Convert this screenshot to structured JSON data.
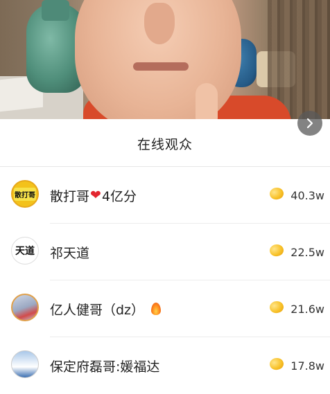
{
  "video": {
    "next_icon": "chevron-right-icon"
  },
  "panel": {
    "title": "在线观众"
  },
  "viewers": [
    {
      "name": "散打哥",
      "suffix": "4亿分",
      "badge_icon": "heart-icon",
      "avatar_text": "散打哥",
      "coins": "40.3w"
    },
    {
      "name": "祁天道",
      "suffix": "",
      "badge_icon": "",
      "avatar_text": "天道",
      "coins": "22.5w"
    },
    {
      "name": "亿人健哥（dz）",
      "suffix": "",
      "badge_icon": "fire-icon",
      "avatar_text": "",
      "coins": "21.6w"
    },
    {
      "name": "保定府磊哥:媛福达",
      "suffix": "",
      "badge_icon": "",
      "avatar_text": "",
      "coins": "17.8w"
    }
  ],
  "colors": {
    "coin": "#f8c22a",
    "heart": "#e3262f",
    "sanda_avatar": "#f3c21b"
  }
}
